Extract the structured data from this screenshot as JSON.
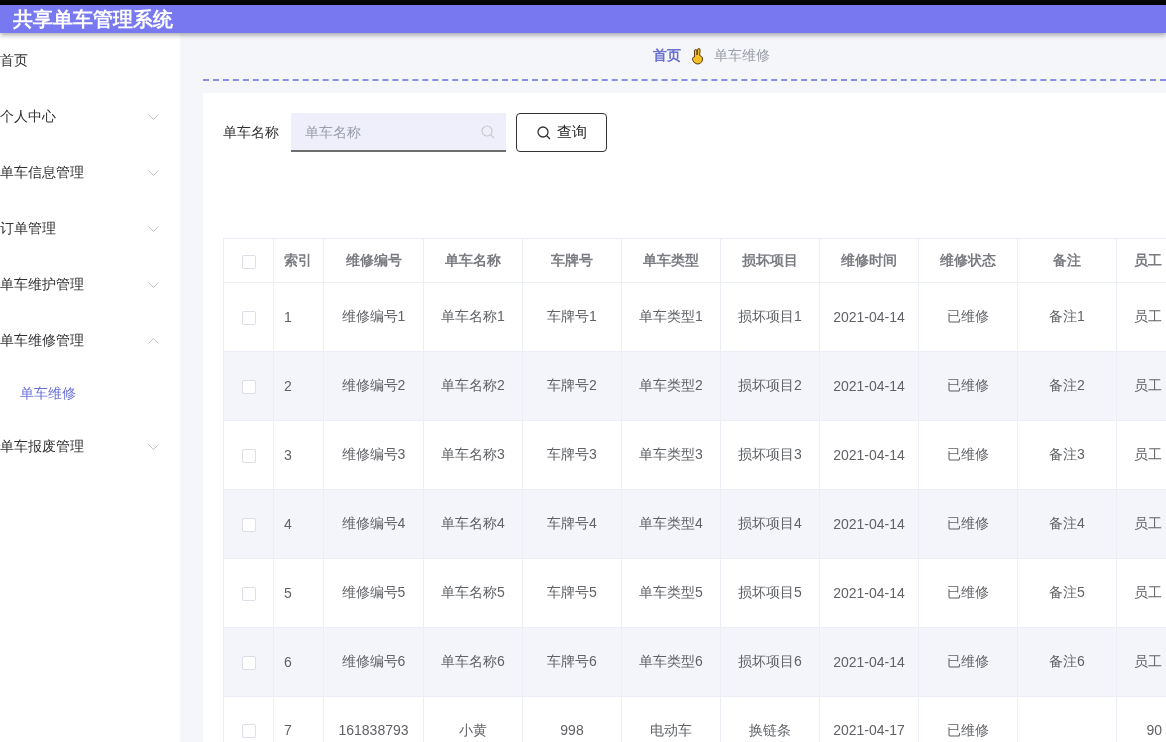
{
  "header": {
    "title": "共享单车管理系统"
  },
  "sidebar": {
    "items": [
      {
        "label": "首页",
        "kind": "link"
      },
      {
        "label": "个人中心",
        "kind": "submenu",
        "expanded": false
      },
      {
        "label": "单车信息管理",
        "kind": "submenu",
        "expanded": false
      },
      {
        "label": "订单管理",
        "kind": "submenu",
        "expanded": false
      },
      {
        "label": "单车维护管理",
        "kind": "submenu",
        "expanded": false
      },
      {
        "label": "单车维修管理",
        "kind": "submenu",
        "expanded": true,
        "children": [
          {
            "label": "单车维修",
            "selected": true
          }
        ]
      },
      {
        "label": "单车报废管理",
        "kind": "submenu",
        "expanded": false
      }
    ]
  },
  "breadcrumb": {
    "items": [
      {
        "label": "首页",
        "current": false
      },
      {
        "label": "单车维修",
        "current": true
      }
    ]
  },
  "search": {
    "label": "单车名称",
    "placeholder": "单车名称",
    "button": "查询"
  },
  "table": {
    "all_checked": false,
    "columns": [
      "索引",
      "维修编号",
      "单车名称",
      "车牌号",
      "单车类型",
      "损坏项目",
      "维修时间",
      "维修状态",
      "备注",
      "员工"
    ],
    "rows": [
      {
        "checked": false,
        "cells": [
          "1",
          "维修编号1",
          "单车名称1",
          "车牌号1",
          "单车类型1",
          "损坏项目1",
          "2021-04-14",
          "已维修",
          "备注1",
          "员工"
        ]
      },
      {
        "checked": false,
        "cells": [
          "2",
          "维修编号2",
          "单车名称2",
          "车牌号2",
          "单车类型2",
          "损坏项目2",
          "2021-04-14",
          "已维修",
          "备注2",
          "员工"
        ]
      },
      {
        "checked": false,
        "cells": [
          "3",
          "维修编号3",
          "单车名称3",
          "车牌号3",
          "单车类型3",
          "损坏项目3",
          "2021-04-14",
          "已维修",
          "备注3",
          "员工"
        ]
      },
      {
        "checked": false,
        "cells": [
          "4",
          "维修编号4",
          "单车名称4",
          "车牌号4",
          "单车类型4",
          "损坏项目4",
          "2021-04-14",
          "已维修",
          "备注4",
          "员工"
        ]
      },
      {
        "checked": false,
        "cells": [
          "5",
          "维修编号5",
          "单车名称5",
          "车牌号5",
          "单车类型5",
          "损坏项目5",
          "2021-04-14",
          "已维修",
          "备注5",
          "员工"
        ]
      },
      {
        "checked": false,
        "cells": [
          "6",
          "维修编号6",
          "单车名称6",
          "车牌号6",
          "单车类型6",
          "损坏项目6",
          "2021-04-14",
          "已维修",
          "备注6",
          "员工"
        ]
      },
      {
        "checked": false,
        "cells": [
          "7",
          "161838793",
          "小黄",
          "998",
          "电动车",
          "换链条",
          "2021-04-17",
          "已维修",
          null,
          "90"
        ]
      }
    ]
  }
}
